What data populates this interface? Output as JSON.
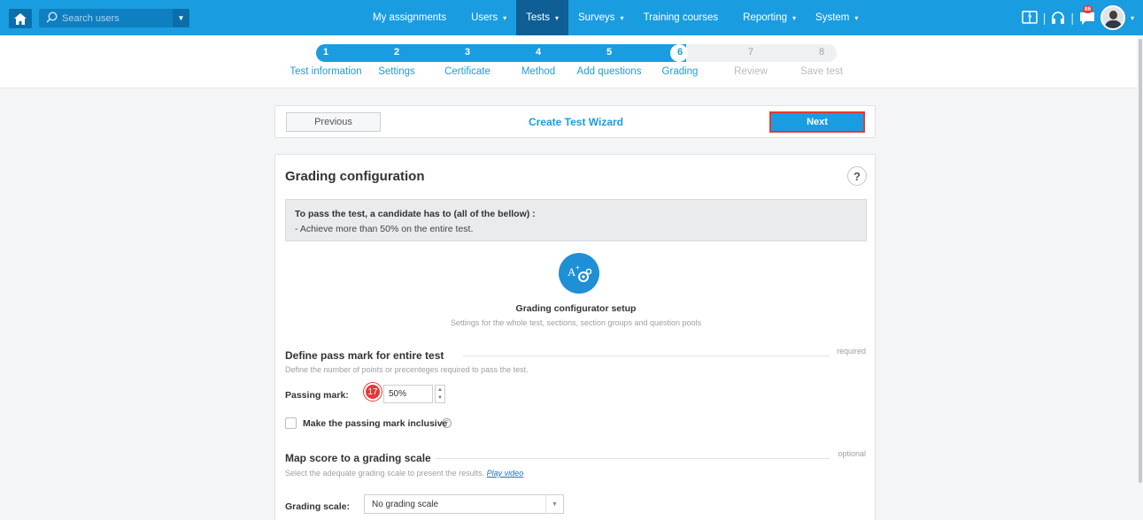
{
  "nav": {
    "search_placeholder": "Search users",
    "menu": [
      {
        "label": "My assignments",
        "caret": ""
      },
      {
        "label": "Users",
        "caret": "▾"
      },
      {
        "label": "Tests",
        "caret": "▾"
      },
      {
        "label": "Surveys",
        "caret": "▾"
      },
      {
        "label": "Training courses",
        "caret": ""
      },
      {
        "label": "Reporting",
        "caret": "▾"
      },
      {
        "label": "System",
        "caret": "▾"
      }
    ],
    "active_menu": "Tests",
    "notification_count": "86",
    "separator": "|",
    "accent_color": "#1a9ce0"
  },
  "stepper": {
    "steps": [
      {
        "num": "1",
        "label": "Test information"
      },
      {
        "num": "2",
        "label": "Settings"
      },
      {
        "num": "3",
        "label": "Certificate"
      },
      {
        "num": "4",
        "label": "Method"
      },
      {
        "num": "5",
        "label": "Add questions"
      },
      {
        "num": "6",
        "label": "Grading"
      },
      {
        "num": "7",
        "label": "Review"
      },
      {
        "num": "8",
        "label": "Save test"
      }
    ],
    "current_step": 6
  },
  "wizard": {
    "previous_label": "Previous",
    "title": "Create Test Wizard",
    "next_label": "Next"
  },
  "grading": {
    "title": "Grading configuration",
    "help": "?",
    "info_line1": "To pass the test, a candidate has to (all of the bellow) :",
    "info_line2": "- Achieve more than 50% on the entire test.",
    "configurator_title": "Grading configurator setup",
    "configurator_subtitle": "Settings for the whole test, sections, section groups and question pools",
    "pass_mark": {
      "title": "Define pass mark for entire test",
      "tag": "required",
      "description": "Define the number of points or precenteges required to pass the test.",
      "label": "Passing mark:",
      "step_badge": "17",
      "value": "50%",
      "inclusive_label": "Make the passing mark inclusive",
      "inclusive_checked": false
    },
    "scale": {
      "title": "Map score to a grading scale",
      "tag": "optional",
      "description": "Select the adequate grading scale to present the results.",
      "video_link": "Play video",
      "label": "Grading scale:",
      "selected": "No grading scale"
    }
  }
}
